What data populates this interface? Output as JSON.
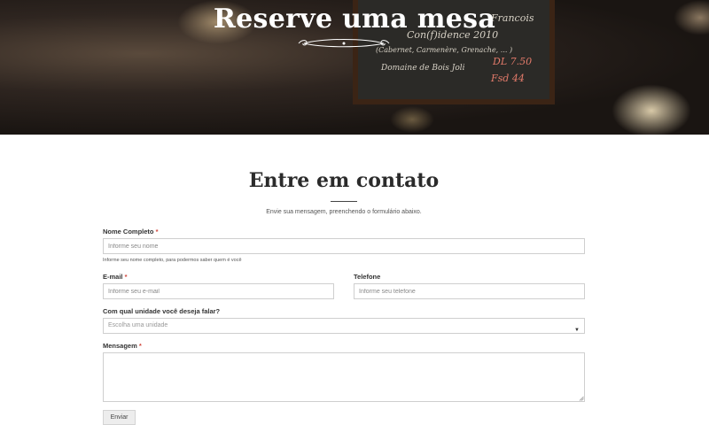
{
  "hero": {
    "title": "Reserve uma mesa",
    "board_lines": [
      "Francois",
      "Con(f)idence 2010",
      "(Cabernet, Carmenère, Grenache, ... )",
      "Domaine de Bois Joli",
      "DL 7.50",
      "Fsd 44"
    ]
  },
  "contact": {
    "title": "Entre em contato",
    "subtitle": "Envie sua mensagem, preenchendo o formulário abaixo."
  },
  "form": {
    "name": {
      "label": "Nome Completo",
      "required": "*",
      "placeholder": "Informe seu nome",
      "hint": "Informe seu nome completo, para podermos saber quem é você"
    },
    "email": {
      "label": "E-mail",
      "required": "*",
      "placeholder": "Informe seu e-mail"
    },
    "phone": {
      "label": "Telefone",
      "placeholder": "Informe seu telefone"
    },
    "unit": {
      "label": "Com qual unidade você deseja falar?",
      "placeholder": "Escolha uma unidade"
    },
    "message": {
      "label": "Mensagem",
      "required": "*"
    },
    "submit_label": "Enviar"
  },
  "colors": {
    "required": "#d0463b",
    "hero_bg": "#1a1512",
    "title": "#2b2b2b"
  },
  "icons": {
    "select_caret": "caret-down-icon",
    "hero_ornament": "flourish-ornament-icon",
    "resize": "resize-grip-icon"
  }
}
